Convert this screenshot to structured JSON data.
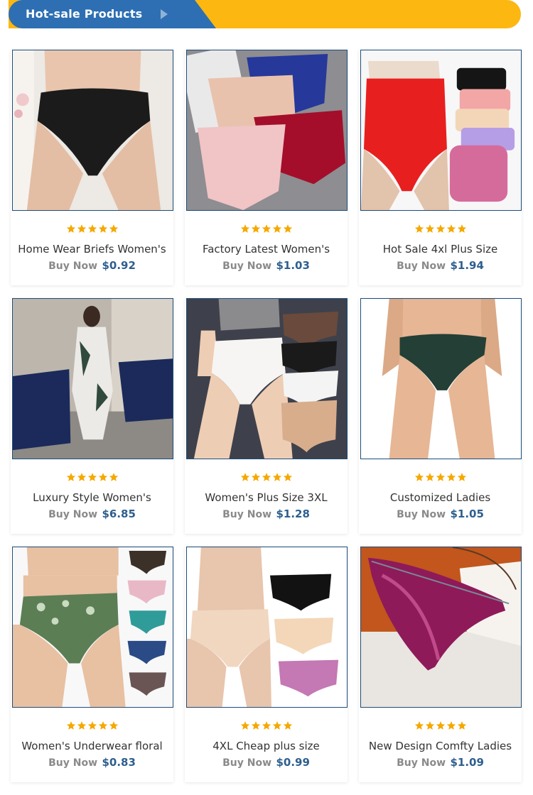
{
  "header": {
    "title": "Hot-sale Products"
  },
  "colors": {
    "banner_blue": "#2d6fb2",
    "banner_yellow": "#fcb711",
    "price": "#2d5f8f",
    "star": "#f5a800"
  },
  "products": [
    {
      "title": "Home Wear Briefs Women's",
      "buy_label": "Buy Now",
      "price": "$0.92",
      "rating": 5,
      "image": "black-briefs-photo"
    },
    {
      "title": "Factory Latest Women's",
      "buy_label": "Buy Now",
      "price": "$1.03",
      "rating": 5,
      "image": "lace-panties-photo"
    },
    {
      "title": "Hot Sale 4xl Plus Size",
      "buy_label": "Buy Now",
      "price": "$1.94",
      "rating": 5,
      "image": "red-high-waist-photo"
    },
    {
      "title": "Luxury Style Women's",
      "buy_label": "Buy Now",
      "price": "$6.85",
      "rating": 5,
      "image": "robe-model-photo"
    },
    {
      "title": "Women's Plus Size 3XL",
      "buy_label": "Buy Now",
      "price": "$1.28",
      "rating": 5,
      "image": "seamless-briefs-photo"
    },
    {
      "title": "Customized Ladies",
      "buy_label": "Buy Now",
      "price": "$1.05",
      "rating": 5,
      "image": "green-thong-photo"
    },
    {
      "title": "Women's Underwear floral",
      "buy_label": "Buy Now",
      "price": "$0.83",
      "rating": 5,
      "image": "floral-briefs-photo"
    },
    {
      "title": "4XL Cheap plus size",
      "buy_label": "Buy Now",
      "price": "$0.99",
      "rating": 5,
      "image": "nude-briefs-photo"
    },
    {
      "title": "New Design Comfty Ladies",
      "buy_label": "Buy Now",
      "price": "$1.09",
      "rating": 5,
      "image": "purple-thong-photo"
    }
  ]
}
